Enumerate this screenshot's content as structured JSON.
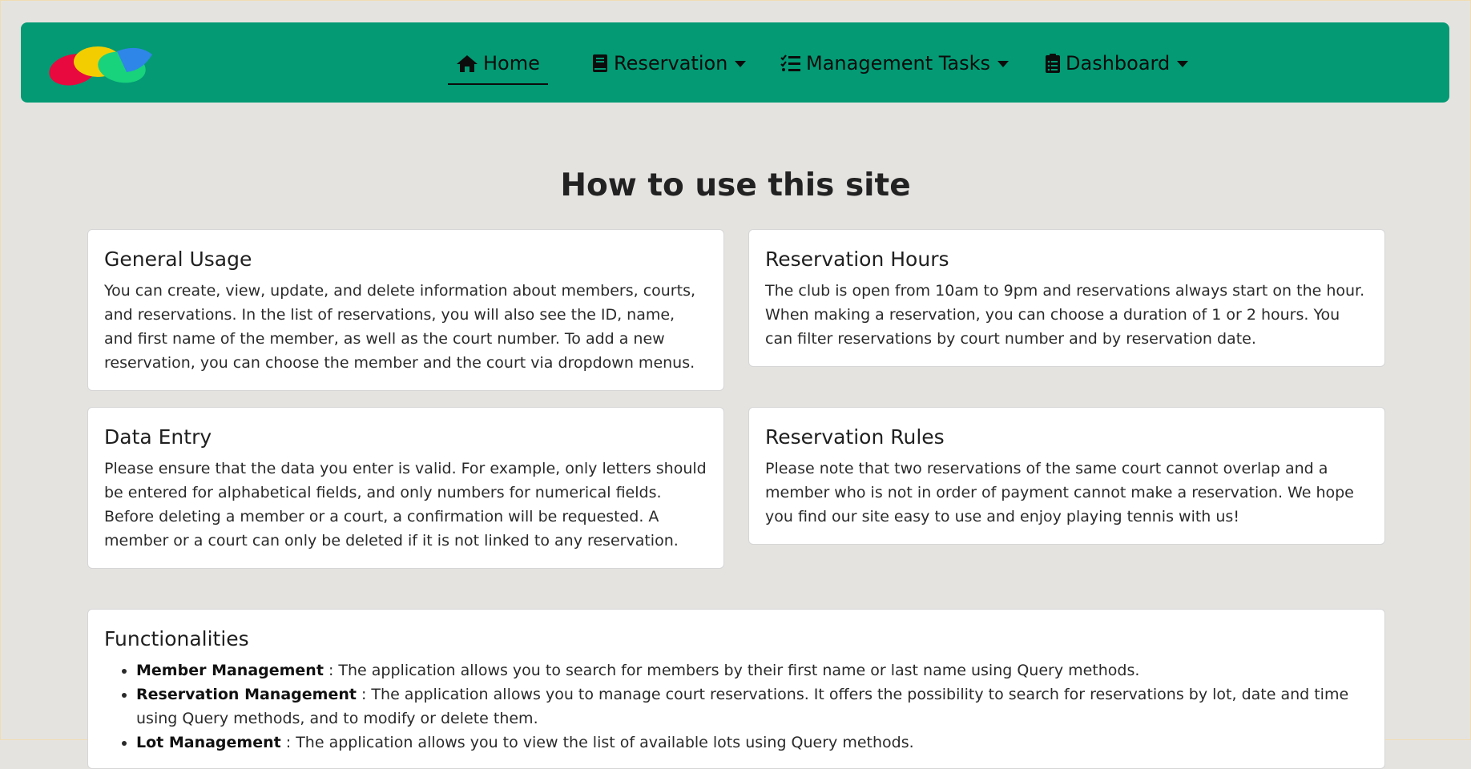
{
  "nav": {
    "items": [
      {
        "label": "Home",
        "icon": "home-icon"
      },
      {
        "label": "Reservation",
        "icon": "book-icon"
      },
      {
        "label": "Management Tasks",
        "icon": "list-check-icon"
      },
      {
        "label": "Dashboard",
        "icon": "clipboard-icon"
      }
    ]
  },
  "page": {
    "title": "How to use this site"
  },
  "cards": {
    "general": {
      "title": "General Usage",
      "text": "You can create, view, update, and delete information about members, courts, and reservations. In the list of reservations, you will also see the ID, name, and first name of the member, as well as the court number. To add a new reservation, you can choose the member and the court via dropdown menus."
    },
    "hours": {
      "title": "Reservation Hours",
      "text": "The club is open from 10am to 9pm and reservations always start on the hour. When making a reservation, you can choose a duration of 1 or 2 hours. You can filter reservations by court number and by reservation date."
    },
    "entry": {
      "title": "Data Entry",
      "text": "Please ensure that the data you enter is valid. For example, only letters should be entered for alphabetical fields, and only numbers for numerical fields. Before deleting a member or a court, a confirmation will be requested. A member or a court can only be deleted if it is not linked to any reservation."
    },
    "rules": {
      "title": "Reservation Rules",
      "text": "Please note that two reservations of the same court cannot overlap and a member who is not in order of payment cannot make a reservation. We hope you find our site easy to use and enjoy playing tennis with us!"
    },
    "functionalities": {
      "title": "Functionalities",
      "items": [
        {
          "name": "Member Management",
          "text": " : The application allows you to search for members by their first name or last name using Query methods."
        },
        {
          "name": "Reservation Management",
          "text": " : The application allows you to manage court reservations. It offers the possibility to search for reservations by lot, date and time using Query methods, and to modify or delete them."
        },
        {
          "name": "Lot Management",
          "text": " : The application allows you to view the list of available lots using Query methods."
        }
      ]
    }
  },
  "colors": {
    "navbar": "#039a74",
    "background": "#e5e3e0"
  }
}
